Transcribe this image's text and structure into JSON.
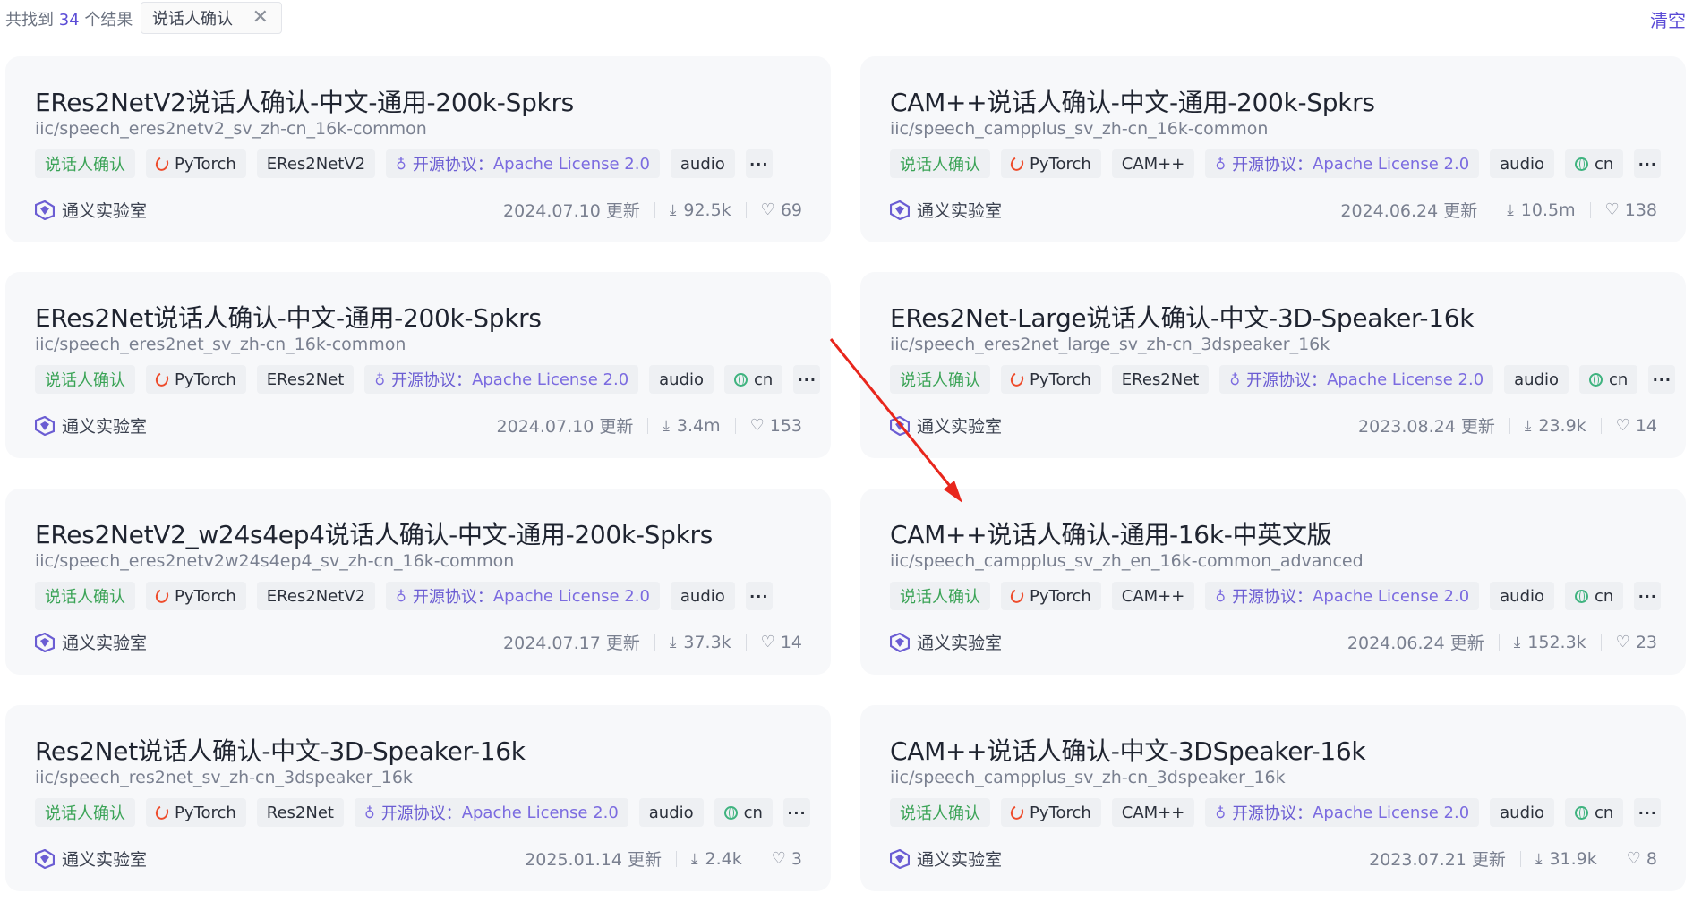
{
  "header": {
    "count_prefix": "共找到",
    "count": "34",
    "count_suffix": "个结果",
    "filter_chip": "说话人确认",
    "clear_label": "清空"
  },
  "license_label": "开源协议：",
  "cards": [
    {
      "title": "ERes2NetV2说话人确认-中文-通用-200k-Spkrs",
      "path": "iic/speech_eres2netv2_sv_zh-cn_16k-common",
      "task": "说话人确认",
      "framework": "PyTorch",
      "arch": "ERes2NetV2",
      "license": "Apache License 2.0",
      "modality": "audio",
      "lang": "",
      "org": "通义实验室",
      "updated": "2024.07.10 更新",
      "downloads": "92.5k",
      "likes": "69"
    },
    {
      "title": "CAM++说话人确认-中文-通用-200k-Spkrs",
      "path": "iic/speech_campplus_sv_zh-cn_16k-common",
      "task": "说话人确认",
      "framework": "PyTorch",
      "arch": "CAM++",
      "license": "Apache License 2.0",
      "modality": "audio",
      "lang": "cn",
      "org": "通义实验室",
      "updated": "2024.06.24 更新",
      "downloads": "10.5m",
      "likes": "138"
    },
    {
      "title": "ERes2Net说话人确认-中文-通用-200k-Spkrs",
      "path": "iic/speech_eres2net_sv_zh-cn_16k-common",
      "task": "说话人确认",
      "framework": "PyTorch",
      "arch": "ERes2Net",
      "license": "Apache License 2.0",
      "modality": "audio",
      "lang": "cn",
      "org": "通义实验室",
      "updated": "2024.07.10 更新",
      "downloads": "3.4m",
      "likes": "153"
    },
    {
      "title": "ERes2Net-Large说话人确认-中文-3D-Speaker-16k",
      "path": "iic/speech_eres2net_large_sv_zh-cn_3dspeaker_16k",
      "task": "说话人确认",
      "framework": "PyTorch",
      "arch": "ERes2Net",
      "license": "Apache License 2.0",
      "modality": "audio",
      "lang": "cn",
      "org": "通义实验室",
      "updated": "2023.08.24 更新",
      "downloads": "23.9k",
      "likes": "14"
    },
    {
      "title": "ERes2NetV2_w24s4ep4说话人确认-中文-通用-200k-Spkrs",
      "path": "iic/speech_eres2netv2w24s4ep4_sv_zh-cn_16k-common",
      "task": "说话人确认",
      "framework": "PyTorch",
      "arch": "ERes2NetV2",
      "license": "Apache License 2.0",
      "modality": "audio",
      "lang": "",
      "org": "通义实验室",
      "updated": "2024.07.17 更新",
      "downloads": "37.3k",
      "likes": "14"
    },
    {
      "title": "CAM++说话人确认-通用-16k-中英文版",
      "path": "iic/speech_campplus_sv_zh_en_16k-common_advanced",
      "task": "说话人确认",
      "framework": "PyTorch",
      "arch": "CAM++",
      "license": "Apache License 2.0",
      "modality": "audio",
      "lang": "cn",
      "org": "通义实验室",
      "updated": "2024.06.24 更新",
      "downloads": "152.3k",
      "likes": "23"
    },
    {
      "title": "Res2Net说话人确认-中文-3D-Speaker-16k",
      "path": "iic/speech_res2net_sv_zh-cn_3dspeaker_16k",
      "task": "说话人确认",
      "framework": "PyTorch",
      "arch": "Res2Net",
      "license": "Apache License 2.0",
      "modality": "audio",
      "lang": "cn",
      "org": "通义实验室",
      "updated": "2025.01.14 更新",
      "downloads": "2.4k",
      "likes": "3"
    },
    {
      "title": "CAM++说话人确认-中文-3DSpeaker-16k",
      "path": "iic/speech_campplus_sv_zh-cn_3dspeaker_16k",
      "task": "说话人确认",
      "framework": "PyTorch",
      "arch": "CAM++",
      "license": "Apache License 2.0",
      "modality": "audio",
      "lang": "cn",
      "org": "通义实验室",
      "updated": "2023.07.21 更新",
      "downloads": "31.9k",
      "likes": "8"
    }
  ],
  "annotation": {
    "color": "#e8261c"
  }
}
